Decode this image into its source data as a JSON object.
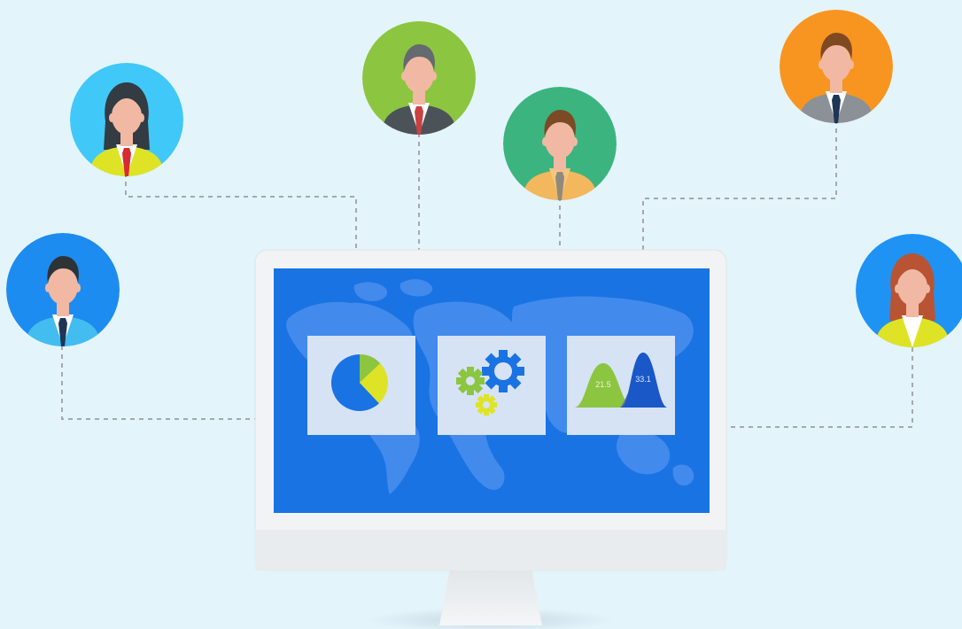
{
  "colors": {
    "background": "#e3f4fb",
    "connector": "#a5a9ab",
    "screen": "#1a73e3",
    "monitor_frame": "#f2f3f4",
    "panel": "#d6e3f5"
  },
  "people": [
    {
      "id": "person-1",
      "bg": "#40c8f8",
      "hair": "#333b43",
      "skin": "#f1b9a3",
      "jacket": "#dfe325",
      "shirt": "#ffffff",
      "tie": "#d72c32",
      "long_hair": true
    },
    {
      "id": "person-2",
      "bg": "#8cc540",
      "hair": "#646a70",
      "skin": "#f1b9a3",
      "jacket": "#4b5359",
      "shirt": "#ffffff",
      "tie": "#ca4143",
      "long_hair": false
    },
    {
      "id": "person-3",
      "bg": "#3cb47f",
      "hair": "#7c4a24",
      "skin": "#f1b9a3",
      "jacket": "#f3b75d",
      "shirt": "#f6c67e",
      "tie": "#8f8a7c",
      "long_hair": false
    },
    {
      "id": "person-4",
      "bg": "#f89520",
      "hair": "#7f4a22",
      "skin": "#f1b9a3",
      "jacket": "#8b9196",
      "shirt": "#ffffff",
      "tie": "#1d3556",
      "long_hair": false
    },
    {
      "id": "person-5",
      "bg": "#1d8cf0",
      "hair": "#2e3338",
      "skin": "#f1b9a3",
      "jacket": "#43bdf0",
      "shirt": "#ffffff",
      "tie": "#1d3556",
      "long_hair": false
    },
    {
      "id": "person-6",
      "bg": "#1e93f4",
      "hair": "#b85434",
      "skin": "#f1b9a3",
      "jacket": "#dfe325",
      "shirt": "#ffffff",
      "tie": "",
      "long_hair": true
    }
  ],
  "panels": {
    "pie_chart": {
      "slices": [
        0.62,
        0.25,
        0.13
      ],
      "colors": [
        "#1a73e3",
        "#dfe325",
        "#8cc540"
      ]
    },
    "gears": {
      "colors": [
        "#1a73e3",
        "#8cc540",
        "#dfe325"
      ]
    },
    "distribution": {
      "series": [
        {
          "label": "21.5",
          "color": "#8cc540"
        },
        {
          "label": "33.1",
          "color": "#1a58c8"
        }
      ]
    }
  }
}
